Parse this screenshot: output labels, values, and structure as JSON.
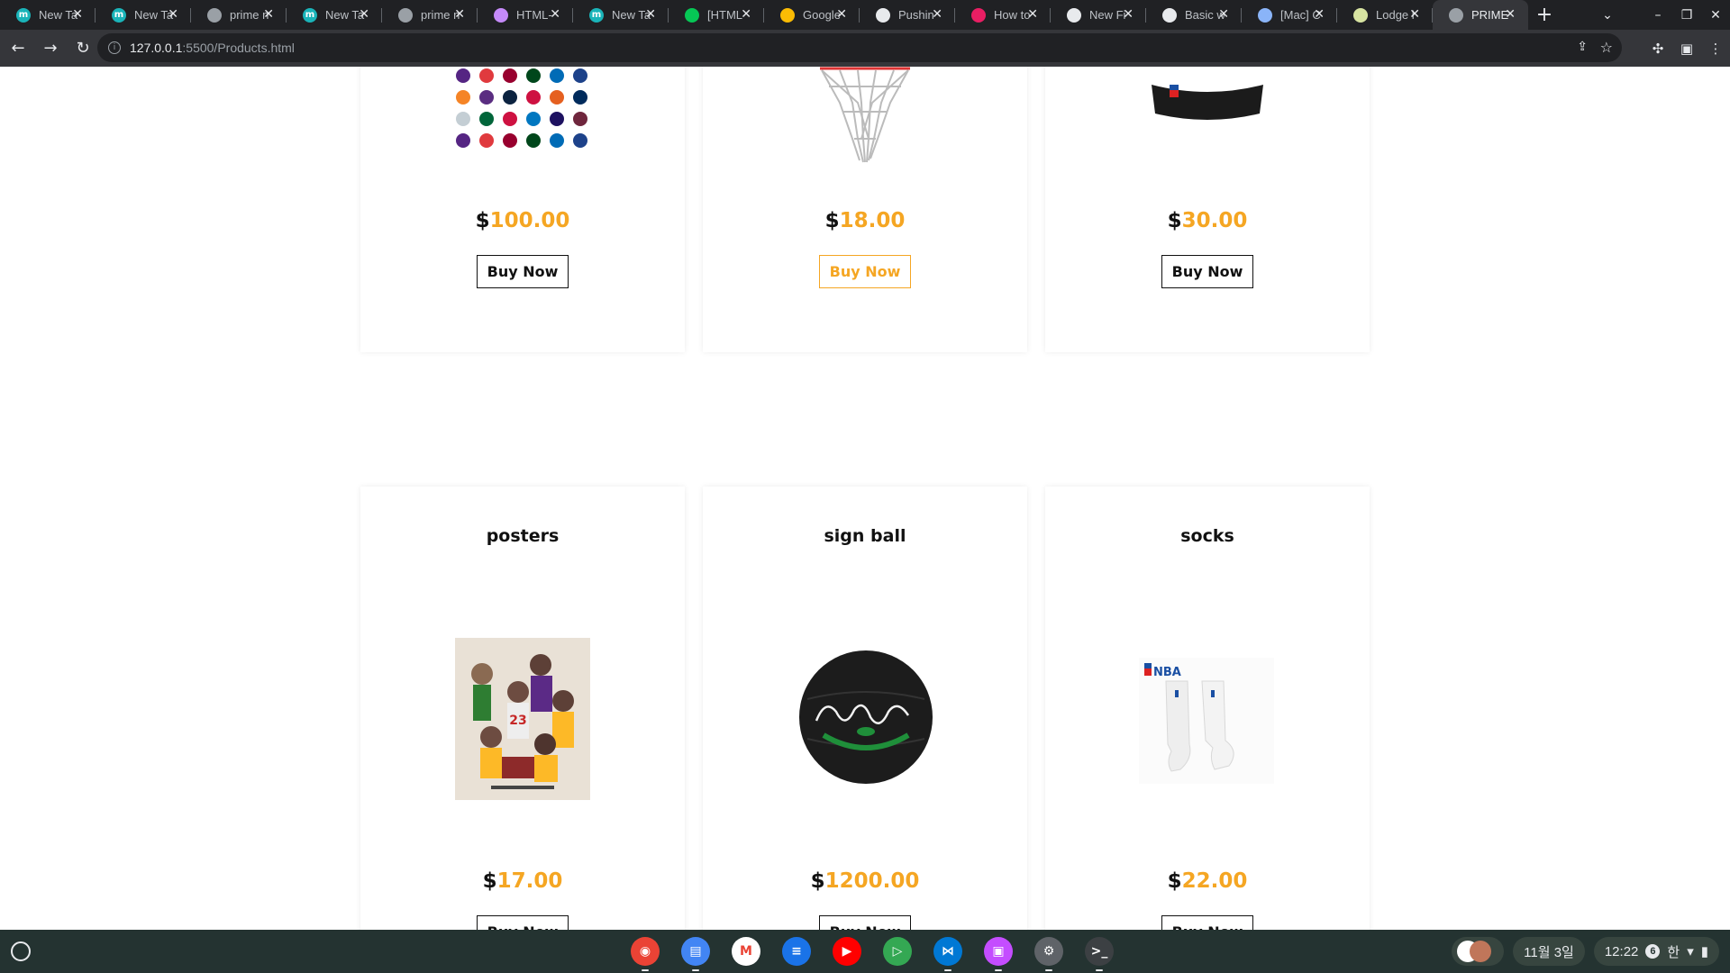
{
  "browser": {
    "tabs": [
      {
        "title": "New Ta",
        "icon": "m-app-icon",
        "color": "#1ab4b9"
      },
      {
        "title": "New Ta",
        "icon": "m-app-icon",
        "color": "#1ab4b9"
      },
      {
        "title": "prime n",
        "icon": "globe-icon",
        "color": "#9aa0a6"
      },
      {
        "title": "New Ta",
        "icon": "m-app-icon",
        "color": "#1ab4b9"
      },
      {
        "title": "prime n",
        "icon": "globe-icon",
        "color": "#9aa0a6"
      },
      {
        "title": "HTML-",
        "icon": "html-doc-icon",
        "color": "#c58af9"
      },
      {
        "title": "New Ta",
        "icon": "m-app-icon",
        "color": "#1ab4b9"
      },
      {
        "title": "[HTML",
        "icon": "line-icon",
        "color": "#06c755"
      },
      {
        "title": "Google",
        "icon": "keep-icon",
        "color": "#fbbc04"
      },
      {
        "title": "Pushin",
        "icon": "github-copilot-icon",
        "color": "#e8eaed"
      },
      {
        "title": "How to",
        "icon": "eye-icon",
        "color": "#e91e63"
      },
      {
        "title": "New Fi",
        "icon": "github-icon",
        "color": "#e8eaed"
      },
      {
        "title": "Basic w",
        "icon": "github-icon",
        "color": "#e8eaed"
      },
      {
        "title": "[Mac] C",
        "icon": "rocket-icon",
        "color": "#8ab4f8"
      },
      {
        "title": "Lodge l",
        "icon": "lodge-icon",
        "color": "#d7e3a1"
      },
      {
        "title": "PRIME",
        "icon": "globe-icon",
        "color": "#9aa0a6",
        "active": true
      }
    ],
    "url_host": "127.0.0.1",
    "url_path": ":5500/Products.html"
  },
  "products_top": [
    {
      "price": "100.00",
      "buy_label": "Buy Now",
      "image": "nba-team-logos"
    },
    {
      "price": "18.00",
      "buy_label": "Buy Now",
      "image": "basketball-net"
    },
    {
      "price": "30.00",
      "buy_label": "Buy Now",
      "image": "nba-headband"
    }
  ],
  "products_bottom": [
    {
      "name": "posters",
      "price": "17.00",
      "image": "legends-poster"
    },
    {
      "name": "sign ball",
      "price": "1200.00",
      "image": "signed-spalding-ball"
    },
    {
      "name": "socks",
      "price": "22.00",
      "image": "nba-socks"
    }
  ],
  "currency_symbol": "$",
  "accent_color": "#f5a623",
  "shelf": {
    "apps": [
      {
        "icon": "chrome-icon"
      },
      {
        "icon": "files-icon"
      },
      {
        "icon": "gmail-icon"
      },
      {
        "icon": "messages-icon"
      },
      {
        "icon": "youtube-icon"
      },
      {
        "icon": "play-store-icon"
      },
      {
        "icon": "vscode-icon"
      },
      {
        "icon": "screencast-icon"
      },
      {
        "icon": "settings-icon"
      },
      {
        "icon": "terminal-icon"
      }
    ],
    "date": "11월 3일",
    "time": "12:22",
    "notifications": "6",
    "ime": "한"
  }
}
